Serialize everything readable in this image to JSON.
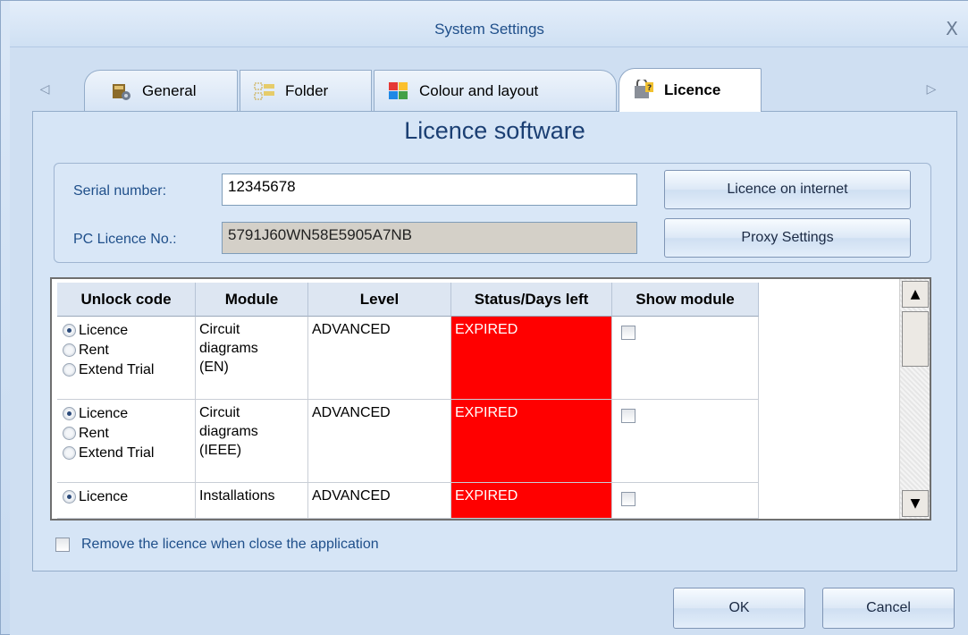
{
  "window": {
    "title": "System Settings",
    "close_glyph": "X"
  },
  "tabs": [
    {
      "label": "General",
      "icon": "general-icon",
      "active": false
    },
    {
      "label": "Folder",
      "icon": "folder-icon",
      "active": false
    },
    {
      "label": "Colour and layout",
      "icon": "colour-layout-icon",
      "active": false
    },
    {
      "label": "Licence",
      "icon": "licence-icon",
      "active": true
    }
  ],
  "tab_nav": {
    "left": "◁",
    "right": "▷"
  },
  "licence": {
    "heading": "Licence software",
    "serial_label": "Serial number:",
    "serial_value": "12345678",
    "pc_label": "PC Licence No.:",
    "pc_value": "5791J60WN58E5905A7NB",
    "licence_internet_button": "Licence on internet",
    "proxy_button": "Proxy Settings"
  },
  "grid": {
    "headers": [
      "Unlock code",
      "Module",
      "Level",
      "Status/Days left",
      "Show module"
    ],
    "radio_labels": [
      "Licence",
      "Rent",
      "Extend Trial"
    ],
    "rows": [
      {
        "module": [
          "Circuit",
          "diagrams",
          "(EN)"
        ],
        "level": "ADVANCED",
        "status": "EXPIRED",
        "selected": 0
      },
      {
        "module": [
          "Circuit",
          "diagrams",
          "(IEEE)"
        ],
        "level": "ADVANCED",
        "status": "EXPIRED",
        "selected": 0
      },
      {
        "module": [
          "Installations"
        ],
        "level": "ADVANCED",
        "status": "EXPIRED",
        "selected": 0
      }
    ],
    "status_color": "#ff0000"
  },
  "remove_licence_label": "Remove the licence when close the application",
  "buttons": {
    "ok": "OK",
    "cancel": "Cancel"
  },
  "scrollbar": {
    "up": "▲",
    "down": "▼"
  }
}
